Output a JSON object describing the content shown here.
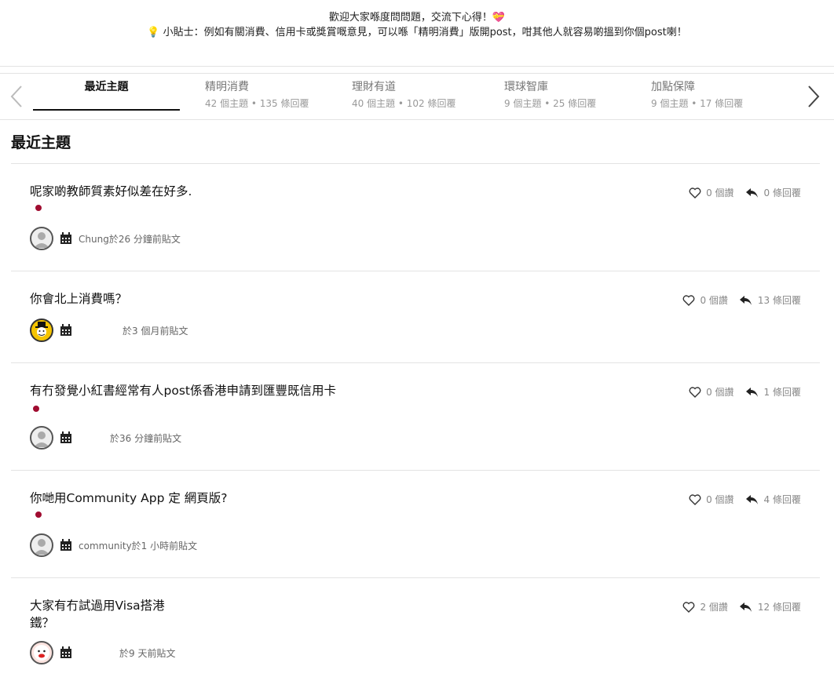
{
  "banner": {
    "line1": "歡迎大家喺度問問題，交流下心得！💝",
    "line2": "💡 小貼士：例如有關消費、信用卡或獎賞嘅意見，可以喺「精明消費」版開post，咁其他人就容易啲搵到你個post喇！"
  },
  "tabs": [
    {
      "title": "最近主題",
      "meta": ""
    },
    {
      "title": "精明消費",
      "meta": "42 個主題 • 135 條回覆"
    },
    {
      "title": "理財有道",
      "meta": "40 個主題 • 102 條回覆"
    },
    {
      "title": "環球智庫",
      "meta": "9 個主題 • 25 條回覆"
    },
    {
      "title": "加點保障",
      "meta": "9 個主題 • 17 條回覆"
    }
  ],
  "section_title": "最近主題",
  "topics": [
    {
      "title": "呢家啲教師質素好似差在好多.",
      "meta": "Chung於26 分鐘前貼文",
      "likes": "0 個讚",
      "replies": "0 條回覆"
    },
    {
      "title": "你會北上消費嗎？",
      "meta": "於3 個月前貼文",
      "likes": "0 個讚",
      "replies": "13 條回覆"
    },
    {
      "title": "有冇發覺小紅書經常有人post係香港申請到匯豐既信用卡",
      "meta": "於36 分鐘前貼文",
      "likes": "0 個讚",
      "replies": "1 條回覆"
    },
    {
      "title": "你哋用Community App 定 網頁版?",
      "meta": "community於1 小時前貼文",
      "likes": "0 個讚",
      "replies": "4 條回覆"
    },
    {
      "title": "大家有冇試過用Visa搭港鐵？",
      "meta": "於9 天前貼文",
      "likes": "2 個讚",
      "replies": "12 條回覆"
    }
  ],
  "colors": {
    "accent": "#a00c30",
    "text": "#111111",
    "muted": "#888888"
  }
}
